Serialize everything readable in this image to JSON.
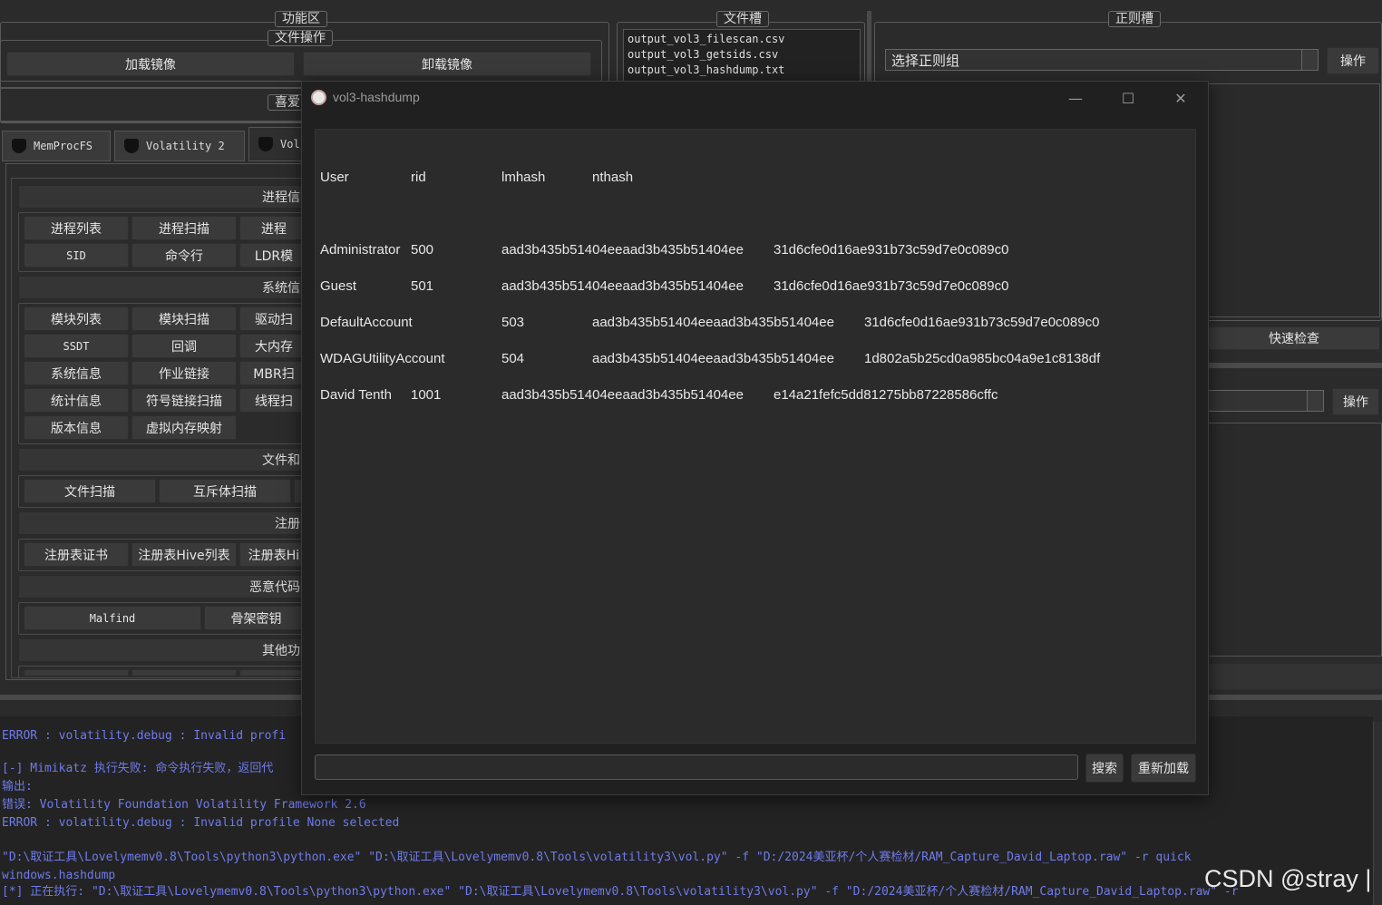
{
  "top_tabs": {
    "function_area": "功能区",
    "file_slot": "文件槽",
    "regex_slot": "正则槽"
  },
  "file_ops": {
    "title": "文件操作",
    "load_image": "加载镜像",
    "unload_image": "卸载镜像"
  },
  "favorites_title": "喜爱",
  "files": [
    "output_vol3_filescan.csv",
    "output_vol3_getsids.csv",
    "output_vol3_hashdump.txt"
  ],
  "regex": {
    "select_group": "选择正则组",
    "operate": "操作",
    "quick_check": "快速检查",
    "operate2": "操作"
  },
  "tool_tabs": [
    "MemProcFS",
    "Volatility 2",
    "Vol"
  ],
  "sections": {
    "process": {
      "title": "进程信",
      "buttons": [
        "进程列表",
        "进程扫描",
        "进程",
        "SID",
        "命令行",
        "LDR模"
      ]
    },
    "system": {
      "title": "系统信",
      "buttons": [
        "模块列表",
        "模块扫描",
        "驱动扫",
        "SSDT",
        "回调",
        "大内存",
        "系统信息",
        "作业链接",
        "MBR扫",
        "统计信息",
        "符号链接扫描",
        "线程扫",
        "版本信息",
        "虚拟内存映射"
      ]
    },
    "files": {
      "title": "文件和",
      "buttons": [
        "文件扫描",
        "互斥体扫描"
      ]
    },
    "registry": {
      "title": "注册",
      "buttons": [
        "注册表证书",
        "注册表Hive列表",
        "注册表Hi"
      ]
    },
    "malware": {
      "title": "恶意代码",
      "buttons": [
        "Malfind",
        "骨架密钥"
      ]
    },
    "other": {
      "title": "其他功"
    }
  },
  "dialog": {
    "title": "vol3-hashdump",
    "minimize": "—",
    "maximize": "☐",
    "close": "✕",
    "headers": [
      "User",
      "rid",
      "lmhash",
      "nthash"
    ],
    "rows": [
      {
        "user": "Administrator",
        "rid": "500",
        "lmhash": "aad3b435b51404eeaad3b435b51404ee",
        "nthash": "31d6cfe0d16ae931b73c59d7e0c089c0"
      },
      {
        "user": "Guest",
        "rid": "501",
        "lmhash": "aad3b435b51404eeaad3b435b51404ee",
        "nthash": "31d6cfe0d16ae931b73c59d7e0c089c0"
      },
      {
        "user": "DefaultAccount",
        "rid": "503",
        "lmhash": "aad3b435b51404eeaad3b435b51404ee",
        "nthash": "31d6cfe0d16ae931b73c59d7e0c089c0"
      },
      {
        "user": "WDAGUtilityAccount",
        "rid": "504",
        "lmhash": "aad3b435b51404eeaad3b435b51404ee",
        "nthash": "1d802a5b25cd0a985bc04a9e1c8138df"
      },
      {
        "user": "David Tenth",
        "rid": "1001",
        "lmhash": "aad3b435b51404eeaad3b435b51404ee",
        "nthash": "e14a21fefc5dd81275bb87228586cffc"
      }
    ],
    "search_button": "搜索",
    "reload_button": "重新加载"
  },
  "log_lines": [
    "ERROR : volatility.debug : Invalid profi",
    "",
    "[-] Mimikatz 执行失败: 命令执行失败，返回代",
    "输出:",
    "错误: Volatility Foundation Volatility Framework 2.6",
    "ERROR : volatility.debug : Invalid profile None selected",
    "",
    "\"D:\\取证工具\\Lovelymemv0.8\\Tools\\python3\\python.exe\" \"D:\\取证工具\\Lovelymemv0.8\\Tools\\volatility3\\vol.py\" -f \"D:/2024美亚杯/个人赛检材/RAM_Capture_David_Laptop.raw\" -r quick",
    "windows.hashdump",
    "[*] 正在执行: \"D:\\取证工具\\Lovelymemv0.8\\Tools\\python3\\python.exe\" \"D:\\取证工具\\Lovelymemv0.8\\Tools\\volatility3\\vol.py\" -f \"D:/2024美亚杯/个人赛检材/RAM_Capture_David_Laptop.raw\" -r"
  ],
  "watermark": "CSDN @stray |",
  "colors": {
    "background": "#2b2b2b",
    "log_text": "#6f7bea",
    "dialog_bg": "#202020"
  }
}
